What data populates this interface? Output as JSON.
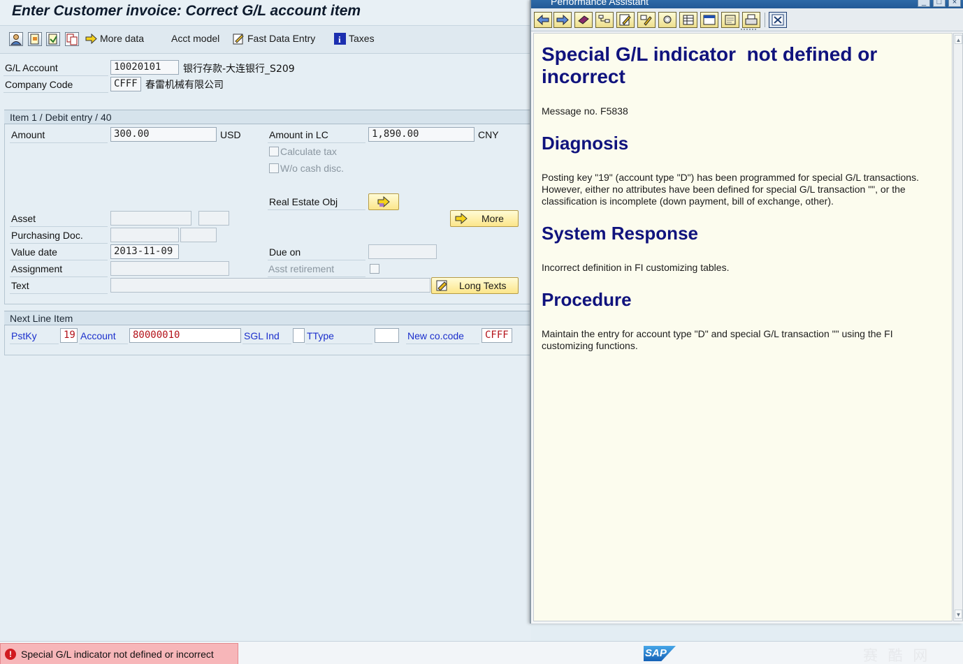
{
  "window_title": "Enter Customer invoice: Correct G/L account item",
  "toolbar": {
    "more_data": "More data",
    "acct_model": "Acct model",
    "fast_data_entry": "Fast Data Entry",
    "taxes": "Taxes"
  },
  "header": {
    "gl_account_label": "G/L Account",
    "gl_account_value": "10020101",
    "gl_account_text": "银行存款-大连银行_S209",
    "company_code_label": "Company Code",
    "company_code_value": "CFFF",
    "company_code_text": "春雷机械有限公司"
  },
  "item": {
    "group_title": "Item 1 / Debit entry / 40",
    "amount_label": "Amount",
    "amount_value": "300.00",
    "amount_currency": "USD",
    "amount_lc_label": "Amount in LC",
    "amount_lc_value": "1,890.00",
    "amount_lc_currency": "CNY",
    "calculate_tax_label": "Calculate tax",
    "wo_cash_disc_label": "W/o cash disc.",
    "real_estate_label": "Real Estate Obj",
    "asset_label": "Asset",
    "more_label": "More",
    "purchasing_doc_label": "Purchasing Doc.",
    "value_date_label": "Value date",
    "value_date_value": "2013-11-09",
    "due_on_label": "Due on",
    "assignment_label": "Assignment",
    "asst_retirement_label": "Asst retirement",
    "text_label": "Text",
    "long_texts_label": "Long Texts"
  },
  "next_line": {
    "group_title": "Next Line Item",
    "pstky_label": "PstKy",
    "pstky_value": "19",
    "account_label": "Account",
    "account_value": "80000010",
    "sgl_ind_label": "SGL Ind",
    "ttype_label": "TType",
    "new_cocode_label": "New co.code",
    "new_cocode_value": "CFFF"
  },
  "status": {
    "message": "Special G/L indicator  not defined or incorrect",
    "sap_logo": "SAP",
    "watermark": "赛 酷 网"
  },
  "assistant": {
    "window_title": "Performance Assistant",
    "doc_title": "Special G/L indicator  not defined or incorrect",
    "message_no": "Message no. F5838",
    "diagnosis_heading": "Diagnosis",
    "diagnosis_text": "Posting key \"19\" (account type \"D\") has been programmed for special G/L transactions. However, either no attributes have been defined for special G/L transaction \"\", or the classification is incomplete (down payment, bill of exchange, other).",
    "system_response_heading": "System Response",
    "system_response_text": "Incorrect definition in FI customizing tables.",
    "procedure_heading": "Procedure",
    "procedure_text": "Maintain the entry for account type \"D\" and special G/L transaction \"\" using the FI customizing functions."
  },
  "colors": {
    "heading_blue": "#10137d",
    "error_bg": "#f7b6b9",
    "doc_bg": "#fcfcee",
    "field_red": "#b3121a",
    "label_blue": "#1b2fcc"
  }
}
